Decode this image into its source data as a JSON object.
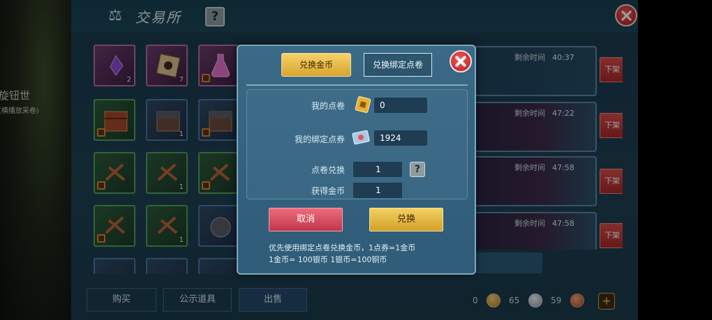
{
  "background": {
    "left_text": [
      "旋钮世",
      "(横播放采卷)"
    ]
  },
  "window": {
    "title": "交易所",
    "help_label": "?"
  },
  "listings": [
    {
      "time_label": "剩余时间",
      "time": "40:37",
      "delist": "下架"
    },
    {
      "time_label": "剩余时间",
      "time": "47:22",
      "delist": "下架"
    },
    {
      "time_label": "剩余时间",
      "time": "47:58",
      "delist": "下架"
    },
    {
      "time_label": "剩余时间",
      "time": "47:58",
      "delist": "下架"
    }
  ],
  "inventory": [
    {
      "count": "2",
      "rarity": "purple",
      "icon": "purple-crystal-icon"
    },
    {
      "count": "7",
      "rarity": "purple",
      "icon": "scroll-icon"
    },
    {
      "count": "",
      "rarity": "purple",
      "icon": "potion-icon"
    },
    {
      "count": "",
      "rarity": "green",
      "icon": "chest-icon"
    },
    {
      "count": "1",
      "rarity": "blue",
      "icon": "chest-icon"
    },
    {
      "count": "",
      "rarity": "blue",
      "icon": "chest-icon"
    },
    {
      "count": "",
      "rarity": "green",
      "icon": "crossbow-icon"
    },
    {
      "count": "1",
      "rarity": "green",
      "icon": "crossbow-icon"
    },
    {
      "count": "",
      "rarity": "green",
      "icon": "crossbow-icon"
    },
    {
      "count": "",
      "rarity": "green",
      "icon": "crossbow-icon"
    },
    {
      "count": "1",
      "rarity": "green",
      "icon": "crossbow-icon"
    },
    {
      "count": "",
      "rarity": "blue",
      "icon": "rock-golem-icon"
    }
  ],
  "bottom_tabs": [
    "购买",
    "公示道具",
    "出售"
  ],
  "currency": {
    "gold": "0",
    "silver": "65",
    "copper": "59",
    "plus": "+"
  },
  "dialog": {
    "tab_coins": "兑换金币",
    "tab_bound": "兑换绑定点卷",
    "my_points_label": "我的点卷",
    "my_points": "0",
    "my_bound_label": "我的绑定点券",
    "my_bound": "1924",
    "exchange_label": "点卷兑换",
    "exchange_value": "1",
    "help": "?",
    "gain_label": "获得金币",
    "gain_value": "1",
    "cancel": "取消",
    "confirm": "兑换",
    "note_1": "优先使用绑定点卷兑换金币，1点券=1金币",
    "note_2": "1金币= 100银币  1银币=100铜币"
  },
  "colors": {
    "accent_gold": "#e0ae3c",
    "accent_red": "#c82c2c",
    "panel_bg": "#1d4052"
  }
}
